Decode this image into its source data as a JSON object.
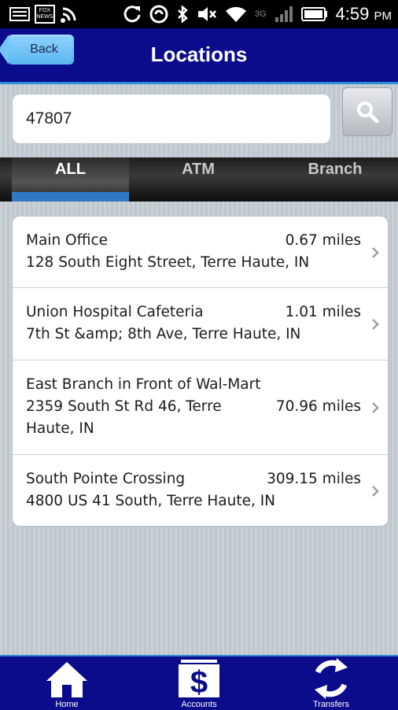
{
  "status_bar": {
    "time": "4:59",
    "ampm": "PM",
    "network": "3G",
    "news_badge": "FOX NEWS",
    "icons": [
      "fox-news-icon",
      "wifi-broadcast-icon",
      "sync-icon",
      "bluetooth-icon",
      "mute-icon",
      "wifi-icon",
      "signal-icon",
      "battery-icon"
    ]
  },
  "header": {
    "back_label": "Back",
    "title": "Locations",
    "colors": {
      "header_bg": "#0a0c8c",
      "back_btn": "#6cc0f5"
    }
  },
  "search": {
    "value": "47807",
    "button_icon": "magnifier-icon"
  },
  "tabs": [
    {
      "label": "ALL",
      "active": true
    },
    {
      "label": "ATM",
      "active": false
    },
    {
      "label": "Branch",
      "active": false
    }
  ],
  "locations": [
    {
      "name": "Main Office",
      "address": "128 South Eight Street, Terre Haute, IN",
      "distance": "0.67 miles"
    },
    {
      "name": "Union Hospital Cafeteria",
      "address": "7th St &amp; 8th Ave, Terre Haute, IN",
      "distance": "1.01 miles"
    },
    {
      "name": "East Branch in Front of Wal-Mart",
      "address_line1": "2359 South St Rd 46, Terre",
      "address_line2": "Haute, IN",
      "distance": "70.96 miles"
    },
    {
      "name": "South Pointe Crossing",
      "address": "4800 US 41 South, Terre Haute, IN",
      "distance": "309.15 miles"
    }
  ],
  "bottom_nav": [
    {
      "label": "Home",
      "icon": "home-icon"
    },
    {
      "label": "Accounts",
      "icon": "dollar-icon"
    },
    {
      "label": "Transfers",
      "icon": "transfer-arrows-icon"
    }
  ]
}
